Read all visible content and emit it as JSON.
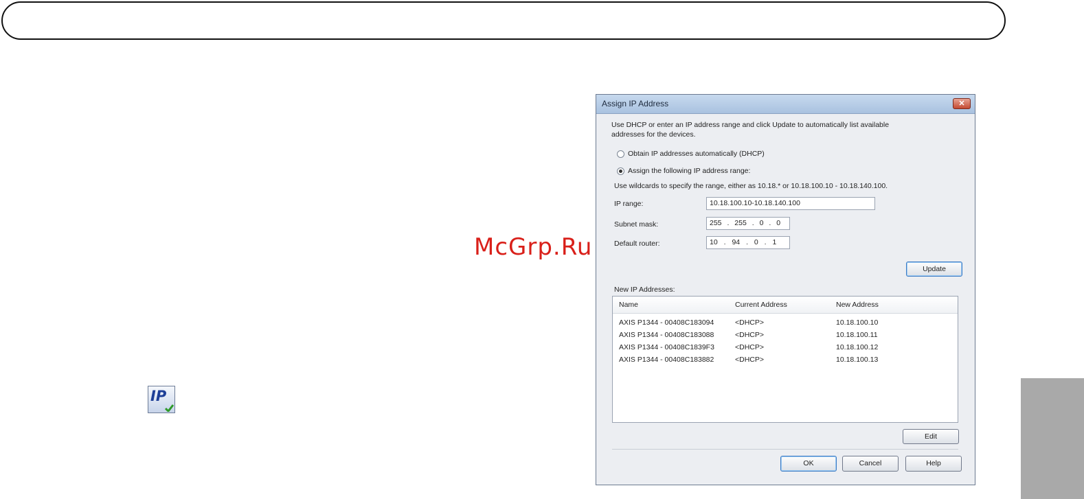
{
  "watermark": "McGrp.Ru",
  "icon": {
    "label": "IP",
    "name": "ip-address-icon"
  },
  "dialog": {
    "title": "Assign IP Address",
    "close_glyph": "✕",
    "description_line1": "Use DHCP or enter an IP address range and click Update to automatically list available",
    "description_line2": "addresses for the devices.",
    "option_dhcp": "Obtain IP addresses automatically (DHCP)",
    "option_range": "Assign the following IP address range:",
    "selected_option": "range",
    "wildcard_hint": "Use wildcards to specify the range, either as 10.18.* or 10.18.100.10 - 10.18.140.100.",
    "ip_range_label": "IP range:",
    "ip_range_value": "10.18.100.10-10.18.140.100",
    "subnet_label": "Subnet mask:",
    "subnet_octets": [
      "255",
      "255",
      "0",
      "0"
    ],
    "router_label": "Default router:",
    "router_octets": [
      "10",
      "94",
      "0",
      "1"
    ],
    "update_button": "Update",
    "new_ip_label": "New IP Addresses:",
    "columns": [
      "Name",
      "Current Address",
      "New Address"
    ],
    "rows": [
      [
        "AXIS P1344 - 00408C183094",
        "<DHCP>",
        "10.18.100.10"
      ],
      [
        "AXIS P1344 - 00408C183088",
        "<DHCP>",
        "10.18.100.11"
      ],
      [
        "AXIS P1344 - 00408C1839F3",
        "<DHCP>",
        "10.18.100.12"
      ],
      [
        "AXIS P1344 - 00408C183882",
        "<DHCP>",
        "10.18.100.13"
      ]
    ],
    "edit_button": "Edit",
    "ok_button": "OK",
    "cancel_button": "Cancel",
    "help_button": "Help"
  },
  "colors": {
    "watermark": "#d9201a",
    "side_tab": "#a9a9a9",
    "titlebar": "#b8cde6"
  }
}
